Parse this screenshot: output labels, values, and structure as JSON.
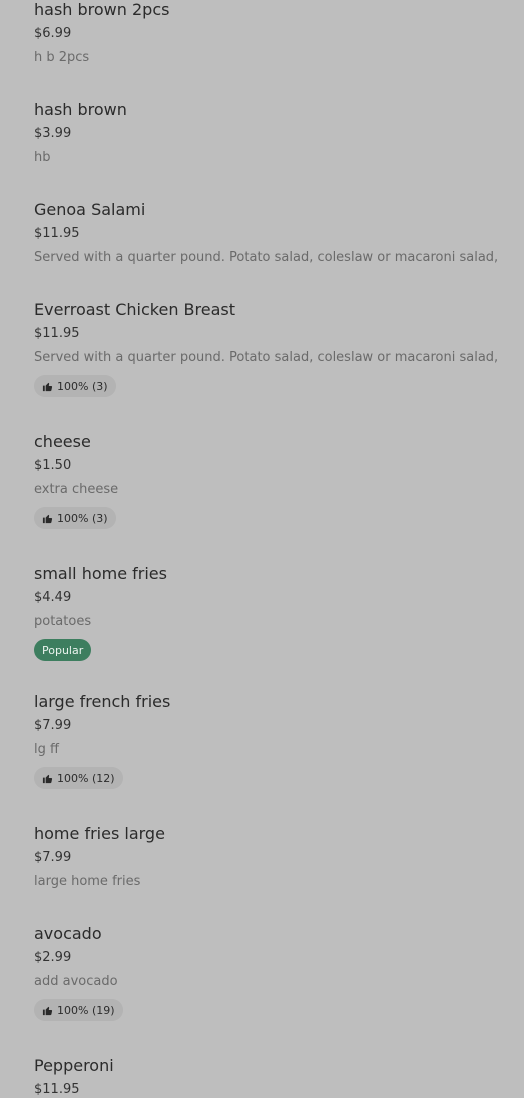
{
  "items": [
    {
      "name": "hash brown 2pcs",
      "price": "$6.99",
      "description": "h b 2pcs"
    },
    {
      "name": "hash brown",
      "price": "$3.99",
      "description": "hb"
    },
    {
      "name": "Genoa Salami",
      "price": "$11.95",
      "description": "Served with a quarter pound. Potato salad, coleslaw or macaroni salad,"
    },
    {
      "name": "Everroast Chicken Breast",
      "price": "$11.95",
      "description": "Served with a quarter pound. Potato salad, coleslaw or macaroni salad,",
      "rating": "100% (3)"
    },
    {
      "name": "cheese",
      "price": "$1.50",
      "description": "extra cheese",
      "rating": "100% (3)"
    },
    {
      "name": "small home fries",
      "price": "$4.49",
      "description": "potatoes",
      "tag": "Popular"
    },
    {
      "name": "large french fries",
      "price": "$7.99",
      "description": "lg ff",
      "rating": "100% (12)"
    },
    {
      "name": "home fries large",
      "price": "$7.99",
      "description": "large home fries"
    },
    {
      "name": "avocado",
      "price": "$2.99",
      "description": "add avocado",
      "rating": "100% (19)"
    },
    {
      "name": "Pepperoni",
      "price": "$11.95",
      "description": ""
    }
  ],
  "icons": {
    "rating": "thumbs-up-icon"
  },
  "colors": {
    "background": "#bebebe",
    "popular_badge": "#3d7e5f"
  }
}
